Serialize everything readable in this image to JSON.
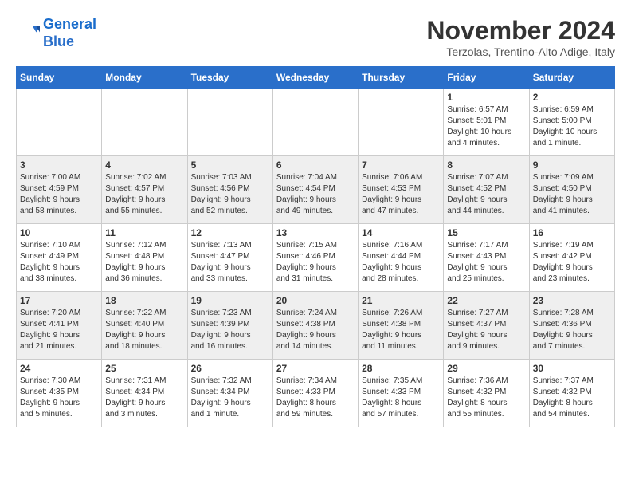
{
  "header": {
    "logo_line1": "General",
    "logo_line2": "Blue",
    "month_title": "November 2024",
    "location": "Terzolas, Trentino-Alto Adige, Italy"
  },
  "weekdays": [
    "Sunday",
    "Monday",
    "Tuesday",
    "Wednesday",
    "Thursday",
    "Friday",
    "Saturday"
  ],
  "rows": [
    {
      "shade": "white",
      "cells": [
        {
          "day": "",
          "info": ""
        },
        {
          "day": "",
          "info": ""
        },
        {
          "day": "",
          "info": ""
        },
        {
          "day": "",
          "info": ""
        },
        {
          "day": "",
          "info": ""
        },
        {
          "day": "1",
          "info": "Sunrise: 6:57 AM\nSunset: 5:01 PM\nDaylight: 10 hours\nand 4 minutes."
        },
        {
          "day": "2",
          "info": "Sunrise: 6:59 AM\nSunset: 5:00 PM\nDaylight: 10 hours\nand 1 minute."
        }
      ]
    },
    {
      "shade": "gray",
      "cells": [
        {
          "day": "3",
          "info": "Sunrise: 7:00 AM\nSunset: 4:59 PM\nDaylight: 9 hours\nand 58 minutes."
        },
        {
          "day": "4",
          "info": "Sunrise: 7:02 AM\nSunset: 4:57 PM\nDaylight: 9 hours\nand 55 minutes."
        },
        {
          "day": "5",
          "info": "Sunrise: 7:03 AM\nSunset: 4:56 PM\nDaylight: 9 hours\nand 52 minutes."
        },
        {
          "day": "6",
          "info": "Sunrise: 7:04 AM\nSunset: 4:54 PM\nDaylight: 9 hours\nand 49 minutes."
        },
        {
          "day": "7",
          "info": "Sunrise: 7:06 AM\nSunset: 4:53 PM\nDaylight: 9 hours\nand 47 minutes."
        },
        {
          "day": "8",
          "info": "Sunrise: 7:07 AM\nSunset: 4:52 PM\nDaylight: 9 hours\nand 44 minutes."
        },
        {
          "day": "9",
          "info": "Sunrise: 7:09 AM\nSunset: 4:50 PM\nDaylight: 9 hours\nand 41 minutes."
        }
      ]
    },
    {
      "shade": "white",
      "cells": [
        {
          "day": "10",
          "info": "Sunrise: 7:10 AM\nSunset: 4:49 PM\nDaylight: 9 hours\nand 38 minutes."
        },
        {
          "day": "11",
          "info": "Sunrise: 7:12 AM\nSunset: 4:48 PM\nDaylight: 9 hours\nand 36 minutes."
        },
        {
          "day": "12",
          "info": "Sunrise: 7:13 AM\nSunset: 4:47 PM\nDaylight: 9 hours\nand 33 minutes."
        },
        {
          "day": "13",
          "info": "Sunrise: 7:15 AM\nSunset: 4:46 PM\nDaylight: 9 hours\nand 31 minutes."
        },
        {
          "day": "14",
          "info": "Sunrise: 7:16 AM\nSunset: 4:44 PM\nDaylight: 9 hours\nand 28 minutes."
        },
        {
          "day": "15",
          "info": "Sunrise: 7:17 AM\nSunset: 4:43 PM\nDaylight: 9 hours\nand 25 minutes."
        },
        {
          "day": "16",
          "info": "Sunrise: 7:19 AM\nSunset: 4:42 PM\nDaylight: 9 hours\nand 23 minutes."
        }
      ]
    },
    {
      "shade": "gray",
      "cells": [
        {
          "day": "17",
          "info": "Sunrise: 7:20 AM\nSunset: 4:41 PM\nDaylight: 9 hours\nand 21 minutes."
        },
        {
          "day": "18",
          "info": "Sunrise: 7:22 AM\nSunset: 4:40 PM\nDaylight: 9 hours\nand 18 minutes."
        },
        {
          "day": "19",
          "info": "Sunrise: 7:23 AM\nSunset: 4:39 PM\nDaylight: 9 hours\nand 16 minutes."
        },
        {
          "day": "20",
          "info": "Sunrise: 7:24 AM\nSunset: 4:38 PM\nDaylight: 9 hours\nand 14 minutes."
        },
        {
          "day": "21",
          "info": "Sunrise: 7:26 AM\nSunset: 4:38 PM\nDaylight: 9 hours\nand 11 minutes."
        },
        {
          "day": "22",
          "info": "Sunrise: 7:27 AM\nSunset: 4:37 PM\nDaylight: 9 hours\nand 9 minutes."
        },
        {
          "day": "23",
          "info": "Sunrise: 7:28 AM\nSunset: 4:36 PM\nDaylight: 9 hours\nand 7 minutes."
        }
      ]
    },
    {
      "shade": "white",
      "cells": [
        {
          "day": "24",
          "info": "Sunrise: 7:30 AM\nSunset: 4:35 PM\nDaylight: 9 hours\nand 5 minutes."
        },
        {
          "day": "25",
          "info": "Sunrise: 7:31 AM\nSunset: 4:34 PM\nDaylight: 9 hours\nand 3 minutes."
        },
        {
          "day": "26",
          "info": "Sunrise: 7:32 AM\nSunset: 4:34 PM\nDaylight: 9 hours\nand 1 minute."
        },
        {
          "day": "27",
          "info": "Sunrise: 7:34 AM\nSunset: 4:33 PM\nDaylight: 8 hours\nand 59 minutes."
        },
        {
          "day": "28",
          "info": "Sunrise: 7:35 AM\nSunset: 4:33 PM\nDaylight: 8 hours\nand 57 minutes."
        },
        {
          "day": "29",
          "info": "Sunrise: 7:36 AM\nSunset: 4:32 PM\nDaylight: 8 hours\nand 55 minutes."
        },
        {
          "day": "30",
          "info": "Sunrise: 7:37 AM\nSunset: 4:32 PM\nDaylight: 8 hours\nand 54 minutes."
        }
      ]
    }
  ]
}
